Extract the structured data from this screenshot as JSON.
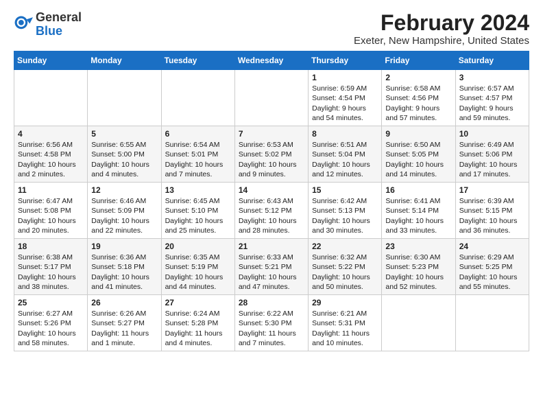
{
  "logo": {
    "general": "General",
    "blue": "Blue"
  },
  "title": "February 2024",
  "location": "Exeter, New Hampshire, United States",
  "days_of_week": [
    "Sunday",
    "Monday",
    "Tuesday",
    "Wednesday",
    "Thursday",
    "Friday",
    "Saturday"
  ],
  "weeks": [
    [
      {
        "day": "",
        "info": ""
      },
      {
        "day": "",
        "info": ""
      },
      {
        "day": "",
        "info": ""
      },
      {
        "day": "",
        "info": ""
      },
      {
        "day": "1",
        "info": "Sunrise: 6:59 AM\nSunset: 4:54 PM\nDaylight: 9 hours\nand 54 minutes."
      },
      {
        "day": "2",
        "info": "Sunrise: 6:58 AM\nSunset: 4:56 PM\nDaylight: 9 hours\nand 57 minutes."
      },
      {
        "day": "3",
        "info": "Sunrise: 6:57 AM\nSunset: 4:57 PM\nDaylight: 9 hours\nand 59 minutes."
      }
    ],
    [
      {
        "day": "4",
        "info": "Sunrise: 6:56 AM\nSunset: 4:58 PM\nDaylight: 10 hours\nand 2 minutes."
      },
      {
        "day": "5",
        "info": "Sunrise: 6:55 AM\nSunset: 5:00 PM\nDaylight: 10 hours\nand 4 minutes."
      },
      {
        "day": "6",
        "info": "Sunrise: 6:54 AM\nSunset: 5:01 PM\nDaylight: 10 hours\nand 7 minutes."
      },
      {
        "day": "7",
        "info": "Sunrise: 6:53 AM\nSunset: 5:02 PM\nDaylight: 10 hours\nand 9 minutes."
      },
      {
        "day": "8",
        "info": "Sunrise: 6:51 AM\nSunset: 5:04 PM\nDaylight: 10 hours\nand 12 minutes."
      },
      {
        "day": "9",
        "info": "Sunrise: 6:50 AM\nSunset: 5:05 PM\nDaylight: 10 hours\nand 14 minutes."
      },
      {
        "day": "10",
        "info": "Sunrise: 6:49 AM\nSunset: 5:06 PM\nDaylight: 10 hours\nand 17 minutes."
      }
    ],
    [
      {
        "day": "11",
        "info": "Sunrise: 6:47 AM\nSunset: 5:08 PM\nDaylight: 10 hours\nand 20 minutes."
      },
      {
        "day": "12",
        "info": "Sunrise: 6:46 AM\nSunset: 5:09 PM\nDaylight: 10 hours\nand 22 minutes."
      },
      {
        "day": "13",
        "info": "Sunrise: 6:45 AM\nSunset: 5:10 PM\nDaylight: 10 hours\nand 25 minutes."
      },
      {
        "day": "14",
        "info": "Sunrise: 6:43 AM\nSunset: 5:12 PM\nDaylight: 10 hours\nand 28 minutes."
      },
      {
        "day": "15",
        "info": "Sunrise: 6:42 AM\nSunset: 5:13 PM\nDaylight: 10 hours\nand 30 minutes."
      },
      {
        "day": "16",
        "info": "Sunrise: 6:41 AM\nSunset: 5:14 PM\nDaylight: 10 hours\nand 33 minutes."
      },
      {
        "day": "17",
        "info": "Sunrise: 6:39 AM\nSunset: 5:15 PM\nDaylight: 10 hours\nand 36 minutes."
      }
    ],
    [
      {
        "day": "18",
        "info": "Sunrise: 6:38 AM\nSunset: 5:17 PM\nDaylight: 10 hours\nand 38 minutes."
      },
      {
        "day": "19",
        "info": "Sunrise: 6:36 AM\nSunset: 5:18 PM\nDaylight: 10 hours\nand 41 minutes."
      },
      {
        "day": "20",
        "info": "Sunrise: 6:35 AM\nSunset: 5:19 PM\nDaylight: 10 hours\nand 44 minutes."
      },
      {
        "day": "21",
        "info": "Sunrise: 6:33 AM\nSunset: 5:21 PM\nDaylight: 10 hours\nand 47 minutes."
      },
      {
        "day": "22",
        "info": "Sunrise: 6:32 AM\nSunset: 5:22 PM\nDaylight: 10 hours\nand 50 minutes."
      },
      {
        "day": "23",
        "info": "Sunrise: 6:30 AM\nSunset: 5:23 PM\nDaylight: 10 hours\nand 52 minutes."
      },
      {
        "day": "24",
        "info": "Sunrise: 6:29 AM\nSunset: 5:25 PM\nDaylight: 10 hours\nand 55 minutes."
      }
    ],
    [
      {
        "day": "25",
        "info": "Sunrise: 6:27 AM\nSunset: 5:26 PM\nDaylight: 10 hours\nand 58 minutes."
      },
      {
        "day": "26",
        "info": "Sunrise: 6:26 AM\nSunset: 5:27 PM\nDaylight: 11 hours\nand 1 minute."
      },
      {
        "day": "27",
        "info": "Sunrise: 6:24 AM\nSunset: 5:28 PM\nDaylight: 11 hours\nand 4 minutes."
      },
      {
        "day": "28",
        "info": "Sunrise: 6:22 AM\nSunset: 5:30 PM\nDaylight: 11 hours\nand 7 minutes."
      },
      {
        "day": "29",
        "info": "Sunrise: 6:21 AM\nSunset: 5:31 PM\nDaylight: 11 hours\nand 10 minutes."
      },
      {
        "day": "",
        "info": ""
      },
      {
        "day": "",
        "info": ""
      }
    ]
  ]
}
